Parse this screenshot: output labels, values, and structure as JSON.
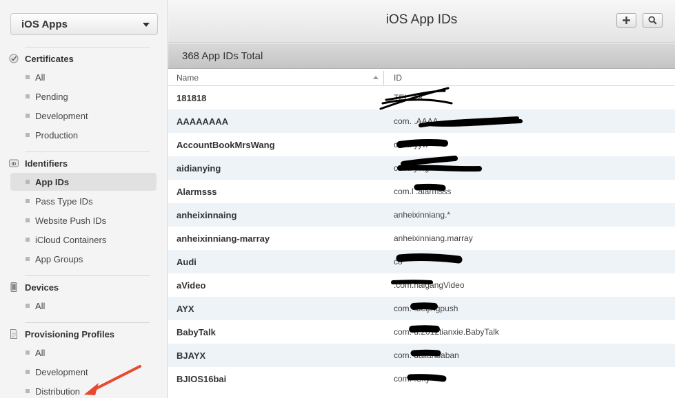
{
  "sidebar": {
    "platform_select": "iOS Apps",
    "sections": [
      {
        "label": "Certificates",
        "items": [
          "All",
          "Pending",
          "Development",
          "Production"
        ]
      },
      {
        "label": "Identifiers",
        "items": [
          "App IDs",
          "Pass Type IDs",
          "Website Push IDs",
          "iCloud Containers",
          "App Groups"
        ]
      },
      {
        "label": "Devices",
        "items": [
          "All"
        ]
      },
      {
        "label": "Provisioning Profiles",
        "items": [
          "All",
          "Development",
          "Distribution"
        ]
      }
    ]
  },
  "header": {
    "title": "iOS App IDs"
  },
  "summary": {
    "total": "368 App IDs Total"
  },
  "table": {
    "columns": [
      "Name",
      "ID"
    ],
    "rows": [
      {
        "name": "181818",
        "id": "TEL.         18"
      },
      {
        "name": "AAAAAAAA",
        "id": "com.                        .AAAA"
      },
      {
        "name": "AccountBookMrsWang",
        "id": "com.             yyw"
      },
      {
        "name": "aidianying",
        "id": "com.                  ying"
      },
      {
        "name": "Alarmsss",
        "id": "com.l          .alarmsss"
      },
      {
        "name": "anheixinnaing",
        "id": "anheixinniang.*"
      },
      {
        "name": "anheixinniang-marray",
        "id": "anheixinniang.marray"
      },
      {
        "name": "Audi",
        "id": "co"
      },
      {
        "name": "aVideo",
        "id": "               .com.haigangVideo"
      },
      {
        "name": "AYX",
        "id": "com.            .beijingpush"
      },
      {
        "name": "BabyTalk",
        "id": "com.            u.2012tianxie.BabyTalk"
      },
      {
        "name": "BJAYX",
        "id": "com.             dalianbaban"
      },
      {
        "name": "BJIOS16bai",
        "id": "com.                .Sky"
      }
    ]
  }
}
